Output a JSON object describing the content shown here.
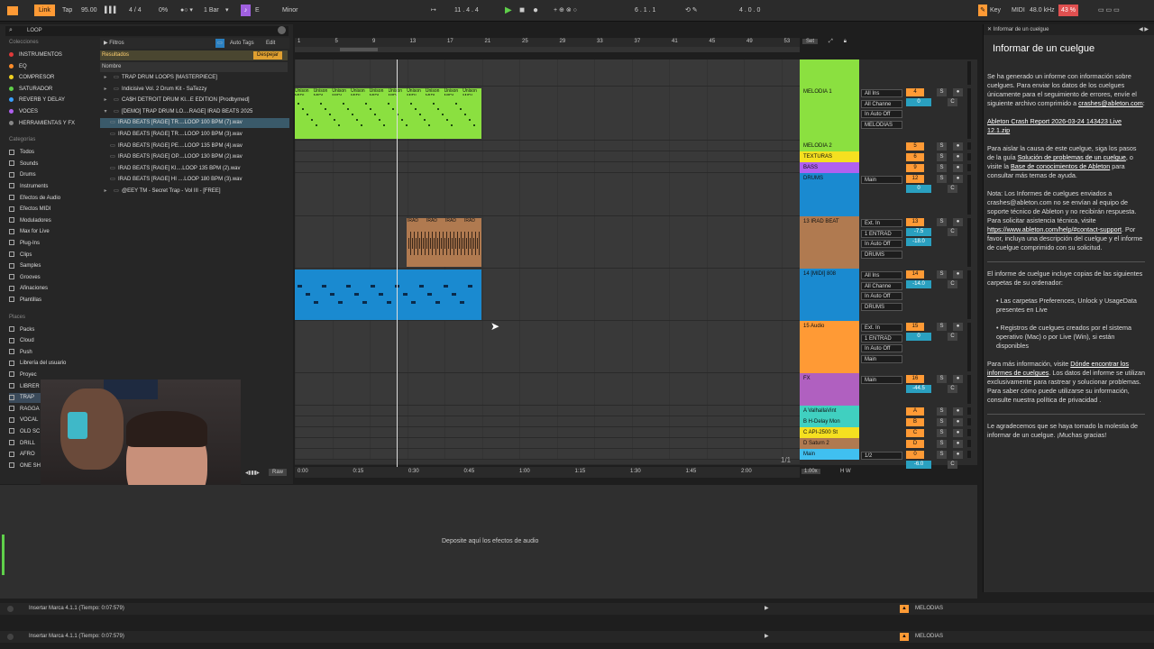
{
  "transport": {
    "link": "Link",
    "tap": "Tap",
    "tempo": "95.00",
    "signature": "4 / 4",
    "cpu": "0%",
    "quantize": "1 Bar",
    "key_root": "E",
    "scale": "Minor",
    "position": "11 . 4 . 4",
    "loop_start": "6 . 1 . 1",
    "loop_length": "4 . 0 . 0",
    "key_label": "Key",
    "midi_label": "MIDI",
    "sample_rate": "48.0 kHz",
    "load": "43 %"
  },
  "browser": {
    "search_text": "LOOP",
    "filters": "Filtros",
    "auto_tags": "Auto Tags",
    "edit": "Edit",
    "results": "Resultados",
    "clear": "Despejar",
    "col_name": "Nombre",
    "collections_head": "Colecciones",
    "collections": [
      {
        "label": "INSTRUMENTOS",
        "color": "#e03a3a"
      },
      {
        "label": "EQ",
        "color": "#ff8c2a"
      },
      {
        "label": "COMPRESOR",
        "color": "#f0d020"
      },
      {
        "label": "SATURADOR",
        "color": "#5fd04a"
      },
      {
        "label": "REVERB Y DELAY",
        "color": "#3aa0ff"
      },
      {
        "label": "VOCES",
        "color": "#b060f0"
      },
      {
        "label": "HERRAMIENTAS Y FX",
        "color": "#888888"
      }
    ],
    "categories_head": "Categorías",
    "categories": [
      "Todos",
      "Sounds",
      "Drums",
      "Instruments",
      "Efectos de Audio",
      "Efectos MIDI",
      "Moduladores",
      "Max for Live",
      "Plug-Ins",
      "Clips",
      "Samples",
      "Grooves",
      "Afinaciones",
      "Plantillas"
    ],
    "places_head": "Places",
    "places": [
      "Packs",
      "Cloud",
      "Push",
      "Librería del usuario",
      "Proyec",
      "LIBRER",
      "TRAP",
      "RAGGA",
      "VOCAL",
      "OLD SC",
      "DRILL",
      "AFRO",
      "ONE SH"
    ],
    "files": [
      "TRAP DRUM LOOPS [MASTERPIECE]",
      "Indicisive Vol. 2 Drum Kit - SaTezzy",
      "CA$H DETROIT DRUM KI...E EDITION [Prodbymed]",
      "[DEMO] TRAP DRUM LO....RAGE] IRAD BEATS 2025",
      "IRAD BEATS [RAGE] TR....LOOP 100 BPM (7).wav",
      "IRAD BEATS [RAGE] TR....LOOP 100 BPM (3).wav",
      "IRAD BEATS [RAGE] PE....LOOP 135 BPM (4).wav",
      "IRAD BEATS [RAGE] OP....LOOP 130 BPM (2).wav",
      "IRAD BEATS [RAGE] KI....LOOP 135 BPM (2).wav",
      "IRAD BEATS [RAGE] HI ....LOOP 180 BPM (3).wav",
      "@EEY TM - Secret Trap - Vol III - [FREE]"
    ],
    "raw": "Raw"
  },
  "ruler": {
    "bars": [
      "1",
      "5",
      "9",
      "13",
      "17",
      "21",
      "25",
      "29",
      "33",
      "37",
      "41",
      "45",
      "49",
      "53"
    ],
    "set": "Set",
    "times": [
      "0:00",
      "0:15",
      "0:30",
      "0:45",
      "1:00",
      "1:15",
      "1:30",
      "1:45",
      "2:00"
    ],
    "page": "1/1"
  },
  "tracks": [
    {
      "name": "",
      "color": "#8be040",
      "num": "",
      "h": 30
    },
    {
      "name": "MELODIA 1",
      "color": "#8be040",
      "num": "4",
      "h": 60,
      "io": [
        "All Ins",
        "All Channe",
        "In Auto Off",
        "MELODIAS"
      ],
      "vol": "0"
    },
    {
      "name": "MELODIA 2",
      "color": "#8be040",
      "num": "5",
      "h": 12
    },
    {
      "name": "TEXTURAS",
      "color": "#f5e020",
      "num": "6",
      "h": 12
    },
    {
      "name": "BASS",
      "color": "#b060f0",
      "num": "9",
      "h": 12
    },
    {
      "name": "DRUMS",
      "color": "#1a8ad0",
      "num": "12",
      "h": 48,
      "io": [
        "Main"
      ],
      "vol": "0"
    },
    {
      "name": "13 IRAD BEAT",
      "color": "#b07a50",
      "num": "13",
      "h": 58,
      "io": [
        "Ext. In",
        "1 ENTRAD",
        "In Auto Off",
        "DRUMS"
      ],
      "vol": "-7.5",
      "vol2": "-18.0"
    },
    {
      "name": "14 [MIDI] 808",
      "color": "#1a8ad0",
      "num": "14",
      "h": 58,
      "io": [
        "All Ins",
        "All Channe",
        "In Auto Off",
        "DRUMS"
      ],
      "vol": "-14.0"
    },
    {
      "name": "15 Audio",
      "color": "#ff9a35",
      "num": "15",
      "h": 58,
      "io": [
        "Ext. In",
        "1 ENTRAD",
        "In Auto Off",
        "Main"
      ],
      "vol": "0"
    },
    {
      "name": "FX",
      "color": "#b060c0",
      "num": "16",
      "h": 36,
      "io": [
        "Main"
      ],
      "vol": "-44.5"
    },
    {
      "name": "A ValhallaVint",
      "color": "#40d0c0",
      "num": "A",
      "h": 12
    },
    {
      "name": "B H-Delay Mon",
      "color": "#40d0c0",
      "num": "B",
      "h": 12
    },
    {
      "name": "C API-2500 St",
      "color": "#f5e020",
      "num": "C",
      "h": 12
    },
    {
      "name": "D Saturn 2",
      "color": "#b07a50",
      "num": "D",
      "h": 12
    },
    {
      "name": "Main",
      "color": "#40c0f0",
      "num": "0",
      "h": 12,
      "io": [
        "1/2"
      ],
      "vol": "-6.0"
    }
  ],
  "clips": {
    "melodia_label": "Unison MIDI",
    "irad_label": "IRAD",
    "midi_label": "MIDI"
  },
  "zoom": "1.00x",
  "hw": "H W",
  "drop_text": "Deposite aquí los efectos de audio",
  "status": {
    "marker1": "Insertar Marca 4.1.1 (Tiempo: 0:07:579)",
    "marker2": "Insertar Marca 4.1.1 (Tiempo: 0:07:579)",
    "track": "MELODIAS"
  },
  "info": {
    "title": "Informar de un cuelgue",
    "header": "Informar de un cuelgue",
    "p1": "Se ha generado un informe con información sobre cuelgues. Para enviar los datos de los cuelgues únicamente para el seguimiento de errores, envíe el siguiente archivo comprimido a ",
    "email": "crashes@ableton.com",
    "file": "Ableton Crash Report 2026-03-24 143423 Live 12.1.zip",
    "p2a": "Para aislar la causa de este cuelgue, siga los pasos de la guía ",
    "p2link1": "Solución de problemas de un cuelgue",
    "p2b": ", o visite la ",
    "p2link2": "Base de conocimientos de Ableton",
    "p2c": " para consultar más temas de ayuda.",
    "p3a": "Nota: Los Informes de cuelgues enviados a crashes@ableton.com no se envían al equipo de soporte técnico de Ableton y no recibirán respuesta. Para solicitar asistencia técnica, visite ",
    "p3link": "https://www.ableton.com/help/#contact-support",
    "p3b": ". Por favor, incluya una descripción del cuelgue y el informe de cuelgue comprimido con su solicitud.",
    "p4": "El informe de cuelgue incluye copias de las siguientes carpetas de su ordenador:",
    "b1": "Las carpetas Preferences, Unlock y UsageData presentes en Live",
    "b2": "Registros de cuelgues creados por el sistema operativo (Mac) o por Live (Win), si están disponibles",
    "p5a": "Para más información, visite ",
    "p5link": "Dónde encontrar los informes de cuelgues",
    "p5b": ". Los datos del informe se utilizan exclusivamente para rastrear y solucionar problemas. Para saber cómo puede utilizarse su información, consulte nuestra política de privacidad .",
    "p6": "Le agradecemos que se haya tomado la molestia de informar de un cuelgue. ¡Muchas gracias!"
  }
}
